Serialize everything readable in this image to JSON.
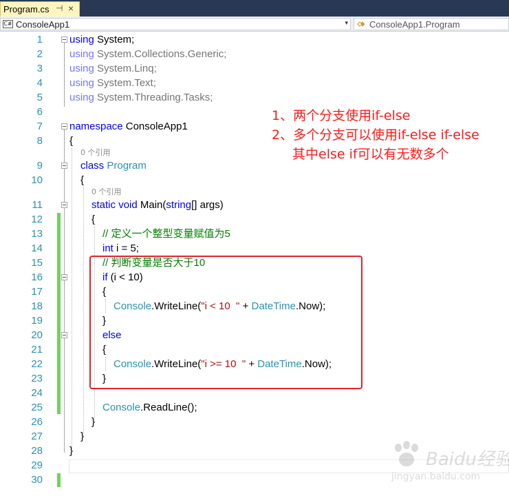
{
  "tab": {
    "title": "Program.cs",
    "pin": "⊣",
    "close": "×"
  },
  "nav": {
    "left_label": "ConsoleApp1",
    "right_label": "ConsoleApp1.Program",
    "arrow": "▾"
  },
  "icons": {
    "cs_badge": "C#"
  },
  "refs": {
    "class_refs": "0 个引用",
    "method_refs": "0 个引用"
  },
  "lines": [
    "1",
    "2",
    "3",
    "4",
    "5",
    "6",
    "7",
    "8",
    "9",
    "10",
    "11",
    "12",
    "13",
    "14",
    "15",
    "16",
    "17",
    "18",
    "19",
    "20",
    "21",
    "22",
    "23",
    "24",
    "25",
    "26",
    "27",
    "28",
    "29",
    "30"
  ],
  "code": {
    "l1_kw": "using",
    "l1_rest": " System;",
    "l2_kw": "using",
    "l2_rest": " System.Collections.Generic;",
    "l3_kw": "using",
    "l3_rest": " System.Linq;",
    "l4_kw": "using",
    "l4_rest": " System.Text;",
    "l5_kw": "using",
    "l5_rest": " System.Threading.Tasks;",
    "l7_kw": "namespace",
    "l7_rest": " ConsoleApp1",
    "open_brace": "{",
    "close_brace": "}",
    "l9_kw": "class",
    "l9_ty": "Program",
    "l11_kw1": "static",
    "l11_kw2": "void",
    "l11_name": " Main(",
    "l11_kw3": "string",
    "l11_rest": "[] args)",
    "l13_cm": "// 定义一个整型变量赋值为5",
    "l14_kw": "int",
    "l14_rest": " i = 5;",
    "l15_cm": "// 判断变量是否大于10",
    "l16_kw": "if",
    "l16_rest": " (i < 10)",
    "l18_ty1": "Console",
    "l18_mid": ".WriteLine(",
    "l18_str": "\"i < 10  \"",
    "l18_plus": " + ",
    "l18_ty2": "DateTime",
    "l18_end": ".Now);",
    "l20_kw": "else",
    "l22_ty1": "Console",
    "l22_mid": ".WriteLine(",
    "l22_str": "\"i >= 10  \"",
    "l22_plus": " + ",
    "l22_ty2": "DateTime",
    "l22_end": ".Now);",
    "l25_ty": "Console",
    "l25_rest": ".ReadLine();"
  },
  "annotations": [
    "1、两个分支使用if-else",
    "2、多个分支可以使用if-else if-else",
    "其中else if可以有无数多个"
  ],
  "watermark": {
    "brand": "Baidu经验",
    "url": "jingyan.baidu.com"
  },
  "colors": {
    "keyword": "#0000ff",
    "type": "#2b91af",
    "string": "#a31515",
    "comment": "#008000",
    "annotation": "#ff1a1a",
    "change_bar": "#6ed35b"
  }
}
